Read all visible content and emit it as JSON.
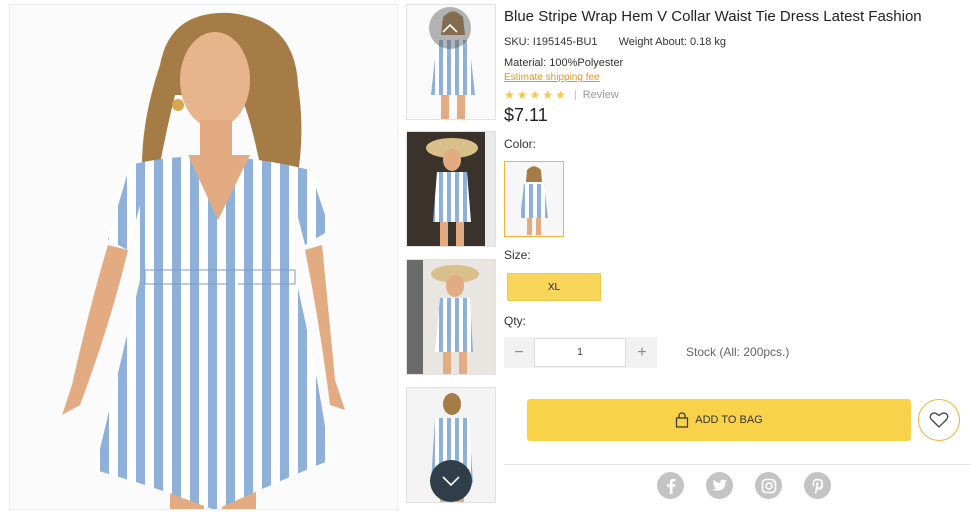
{
  "product": {
    "title": "Blue Stripe Wrap Hem V Collar Waist Tie Dress Latest Fashion",
    "sku": "SKU: I195145-BU1",
    "weight": "Weight About: 0.18 kg",
    "material": "Material: 100%Polyester",
    "shipping_link": "Estimate shipping fee",
    "rating": {
      "stars": 5,
      "separator": "|",
      "review_label": "Review"
    },
    "price": "$7.11"
  },
  "options": {
    "color_label": "Color:",
    "size_label": "Size:",
    "size_selected": "XL",
    "qty_label": "Qty:",
    "qty_value": "1",
    "qty_minus": "−",
    "qty_plus": "+",
    "stock": "Stock (All: 200pcs.)"
  },
  "actions": {
    "add_to_bag": "ADD TO BAG"
  },
  "icons": {
    "thumb_up": "chevron-up-icon",
    "thumb_down": "chevron-down-icon",
    "bag": "shopping-bag-icon",
    "wishlist": "heart-icon",
    "social": [
      "facebook-icon",
      "twitter-icon",
      "instagram-icon",
      "pinterest-icon"
    ]
  },
  "colors": {
    "accent": "#f8d34a",
    "link": "#e8941b",
    "stripe": "#8fb0d8",
    "social": "#c4c4c4"
  }
}
